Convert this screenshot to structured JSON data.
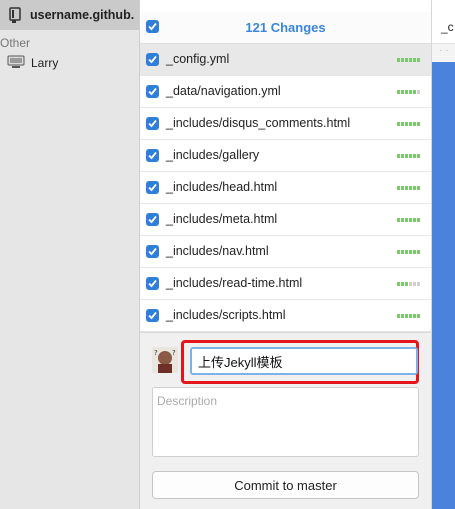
{
  "sidebar": {
    "active_repo": "username.github.io",
    "section_header": "Other",
    "other_repos": [
      {
        "label": "Larry"
      }
    ]
  },
  "changes": {
    "title": "121 Changes",
    "files": [
      {
        "name": "_config.yml",
        "selected": true,
        "checked": true,
        "diff": [
          1,
          1,
          1,
          1,
          1,
          1
        ]
      },
      {
        "name": "_data/navigation.yml",
        "selected": false,
        "checked": true,
        "diff": [
          1,
          1,
          1,
          1,
          1,
          0
        ]
      },
      {
        "name": "_includes/disqus_comments.html",
        "selected": false,
        "checked": true,
        "diff": [
          1,
          1,
          1,
          1,
          1,
          1
        ]
      },
      {
        "name": "_includes/gallery",
        "selected": false,
        "checked": true,
        "diff": [
          1,
          1,
          1,
          1,
          1,
          1
        ]
      },
      {
        "name": "_includes/head.html",
        "selected": false,
        "checked": true,
        "diff": [
          1,
          1,
          1,
          1,
          1,
          1
        ]
      },
      {
        "name": "_includes/meta.html",
        "selected": false,
        "checked": true,
        "diff": [
          1,
          1,
          1,
          1,
          1,
          1
        ]
      },
      {
        "name": "_includes/nav.html",
        "selected": false,
        "checked": true,
        "diff": [
          1,
          1,
          1,
          1,
          1,
          1
        ]
      },
      {
        "name": "_includes/read-time.html",
        "selected": false,
        "checked": true,
        "diff": [
          1,
          1,
          1,
          0,
          0,
          0
        ]
      },
      {
        "name": "_includes/scripts.html",
        "selected": false,
        "checked": true,
        "diff": [
          1,
          1,
          1,
          1,
          1,
          1
        ]
      }
    ]
  },
  "commit": {
    "summary_value": "上传Jekyll模板",
    "description_placeholder": "Description",
    "commit_button": "Commit to master"
  },
  "right_pane": {
    "header_text": "_c"
  },
  "colors": {
    "accent": "#2f7ed8",
    "diff_added": "#7cc96b",
    "highlight": "#e3161b"
  }
}
